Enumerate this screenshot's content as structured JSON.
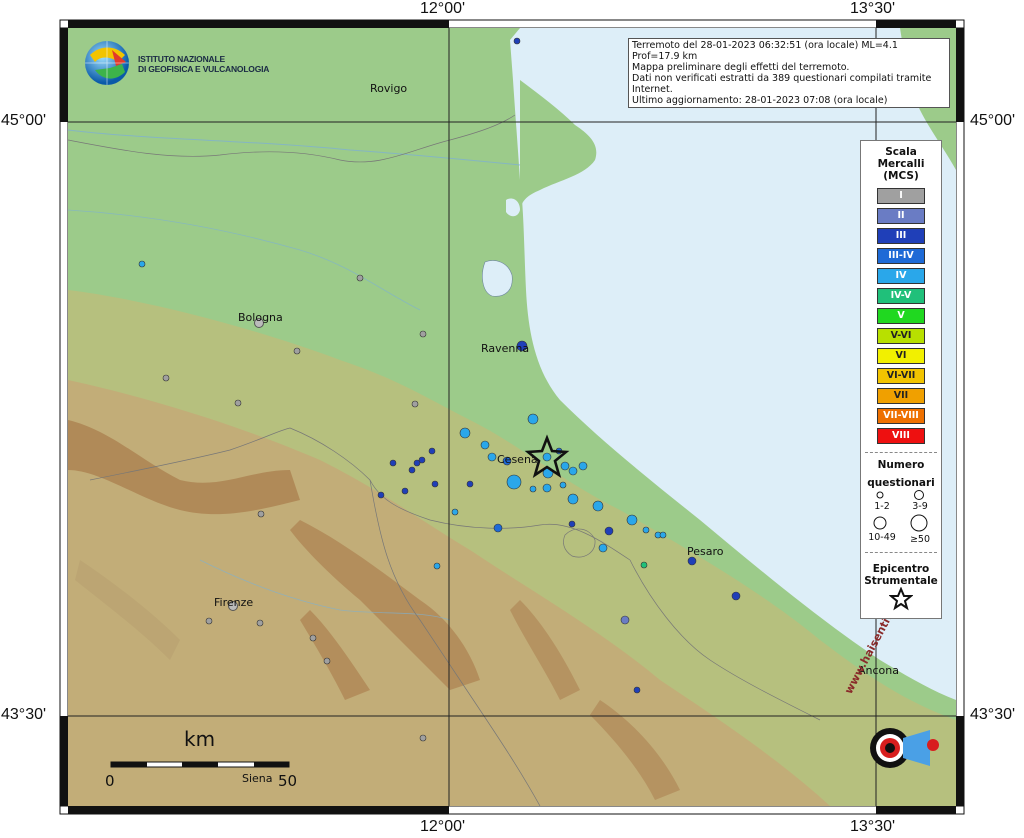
{
  "info_box": {
    "line1": "Terremoto del 28-01-2023 06:32:51 (ora locale) ML=4.1 Prof=17.9 km",
    "line2": "Mappa preliminare degli effetti del terremoto.",
    "line3": "Dati non verificati estratti da 389 questionari compilati tramite Internet.",
    "line4": "Ultimo aggiornamento: 28-01-2023 07:08 (ora locale)"
  },
  "logo": {
    "line1": "ISTITUTO NAZIONALE",
    "line2": "DI GEOFISICA E VULCANOLOGIA"
  },
  "coords": {
    "top_left_lon": "12°00'",
    "top_right_lon": "13°30'",
    "bottom_left_lon": "12°00'",
    "bottom_right_lon": "13°30'",
    "left_top_lat": "45°00'",
    "right_top_lat": "45°00'",
    "left_bottom_lat": "43°30'",
    "right_bottom_lat": "43°30'"
  },
  "cities": {
    "rovigo": "Rovigo",
    "bologna": "Bologna",
    "ravenna": "Ravenna",
    "cesena": "Cesena",
    "pesaro": "Pesaro",
    "firenze": "Firenze",
    "ancona": "Ancona",
    "siena": "Siena"
  },
  "scale_bar": {
    "unit": "km",
    "min": "0",
    "max": "50"
  },
  "legend": {
    "title_line1": "Scala",
    "title_line2": "Mercalli",
    "title_line3": "(MCS)",
    "levels": [
      {
        "label": "I",
        "color": "#a0a0a0"
      },
      {
        "label": "II",
        "color": "#6a7cc4"
      },
      {
        "label": "III",
        "color": "#1f3fb8"
      },
      {
        "label": "III-IV",
        "color": "#1e6ad6"
      },
      {
        "label": "IV",
        "color": "#2aa7ea"
      },
      {
        "label": "IV-V",
        "color": "#20c07a"
      },
      {
        "label": "V",
        "color": "#20d820"
      },
      {
        "label": "V-VI",
        "color": "#b8e000"
      },
      {
        "label": "VI",
        "color": "#f2f000"
      },
      {
        "label": "VI-VII",
        "color": "#f2c400"
      },
      {
        "label": "VII",
        "color": "#f0a000"
      },
      {
        "label": "VII-VIII",
        "color": "#ee7000"
      },
      {
        "label": "VIII",
        "color": "#ee1010"
      }
    ],
    "count_title1": "Numero",
    "count_title2": "questionari",
    "count_classes": [
      "1-2",
      "3-9",
      "10-49",
      "≥50"
    ],
    "epicenter_title1": "Epicentro",
    "epicenter_title2": "Strumentale"
  },
  "website_logo": {
    "text": "www.haisentitoilterremoto.it"
  },
  "colors": {
    "sea": "#ddeef8",
    "plain": "#9ccb8a",
    "hills": "#c6b07a",
    "mountains": "#a87a4a"
  }
}
